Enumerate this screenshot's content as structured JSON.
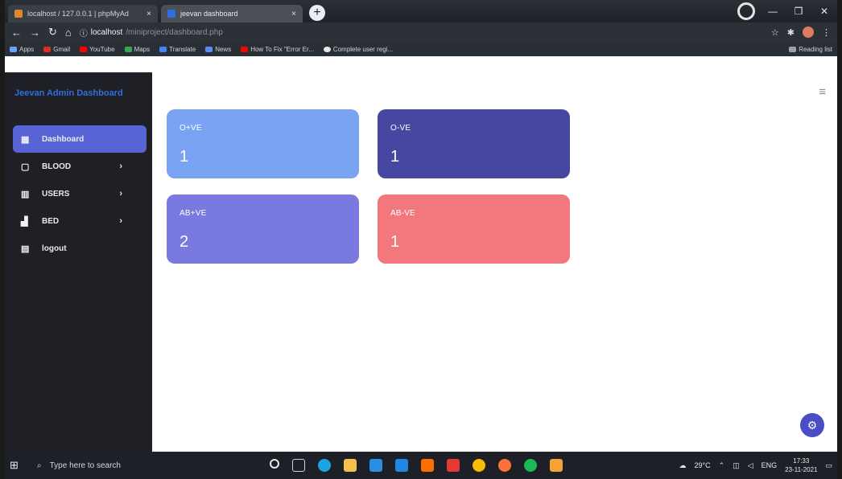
{
  "browser": {
    "tabs": [
      {
        "label": "localhost / 127.0.0.1 | phpMyAd",
        "active": false
      },
      {
        "label": "jeevan dashboard",
        "active": true
      }
    ],
    "new_tab": "+",
    "url_host": "localhost",
    "url_path": "/miniproject/dashboard.php",
    "bookmarks": [
      "Apps",
      "Gmail",
      "YouTube",
      "Maps",
      "Translate",
      "News",
      "How To Fix \"Error Er...",
      "Complete user regi..."
    ],
    "reading_list": "Reading list"
  },
  "sidebar": {
    "brand": "Jeevan Admin Dashboard",
    "items": [
      {
        "label": "Dashboard",
        "icon": "grid-icon",
        "glyph": "▦",
        "active": true,
        "has_submenu": false
      },
      {
        "label": "BLOOD",
        "icon": "box-icon",
        "glyph": "▢",
        "active": false,
        "has_submenu": true
      },
      {
        "label": "USERS",
        "icon": "columns-icon",
        "glyph": "▥",
        "active": false,
        "has_submenu": true
      },
      {
        "label": "BED",
        "icon": "bar-chart-icon",
        "glyph": "▟",
        "active": false,
        "has_submenu": true
      },
      {
        "label": "logout",
        "icon": "logout-icon",
        "glyph": "▤",
        "active": false,
        "has_submenu": false
      }
    ],
    "chevron": "›"
  },
  "cards": [
    {
      "label": "O+VE",
      "value": "1",
      "color": "#7aa4f3"
    },
    {
      "label": "O-VE",
      "value": "1",
      "color": "#4747a1"
    },
    {
      "label": "AB+VE",
      "value": "2",
      "color": "#7a79e0"
    },
    {
      "label": "AB-VE",
      "value": "1",
      "color": "#f2787e"
    }
  ],
  "header": {
    "menu_icon": "≡"
  },
  "fab": {
    "icon": "gear-icon",
    "glyph": "⚙"
  },
  "taskbar": {
    "search_placeholder": "Type here to search",
    "weather": "29°C",
    "language": "ENG",
    "time": "17:33",
    "date": "23-11-2021"
  },
  "colors": {
    "sidebar_bg": "#1e2025",
    "active_item": "#5864d6",
    "brand": "#2f6fdc"
  }
}
